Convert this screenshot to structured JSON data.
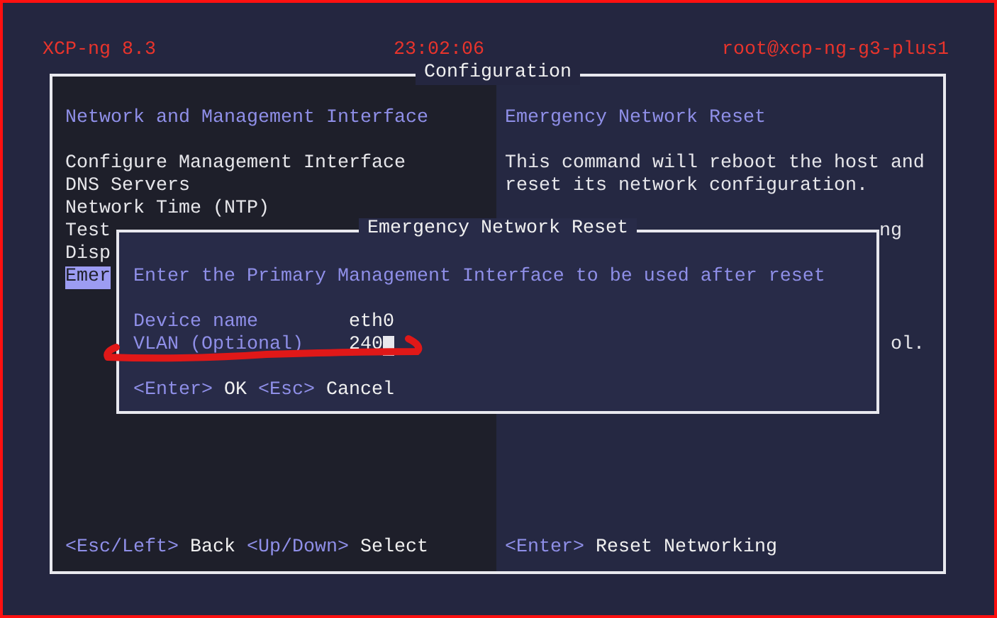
{
  "header": {
    "product": "XCP-ng 8.3",
    "clock": "23:02:06",
    "user_host": "root@xcp-ng-g3-plus1"
  },
  "panel": {
    "title": "Configuration"
  },
  "menu": {
    "heading": "Network and Management Interface",
    "items": [
      {
        "label": "Configure Management Interface",
        "selected": false
      },
      {
        "label": "DNS Servers",
        "selected": false
      },
      {
        "label": "Network Time (NTP)",
        "selected": false
      },
      {
        "label": "Test",
        "selected": false
      },
      {
        "label": "Disp",
        "selected": false
      },
      {
        "label": "Emer",
        "selected": true
      }
    ],
    "hints": [
      {
        "key": "<Esc/Left>",
        "action": "Back"
      },
      {
        "key": "<Up/Down>",
        "action": "Select"
      }
    ]
  },
  "detail": {
    "heading": "Emergency Network Reset",
    "description": [
      "This command will reboot the host and",
      "reset its network configuration."
    ],
    "fragments": [
      "ng",
      "ol."
    ],
    "hints": [
      {
        "key": "<Enter>",
        "action": "Reset Networking"
      }
    ]
  },
  "dialog": {
    "title": "Emergency Network Reset",
    "prompt": "Enter the Primary Management Interface to be used after reset",
    "fields": [
      {
        "label": "Device name",
        "value": "eth0",
        "focused": false
      },
      {
        "label": "VLAN (Optional)",
        "value": "240",
        "focused": true
      }
    ],
    "hints": [
      {
        "key": "<Enter>",
        "action": "OK"
      },
      {
        "key": "<Esc>",
        "action": "Cancel"
      }
    ]
  }
}
